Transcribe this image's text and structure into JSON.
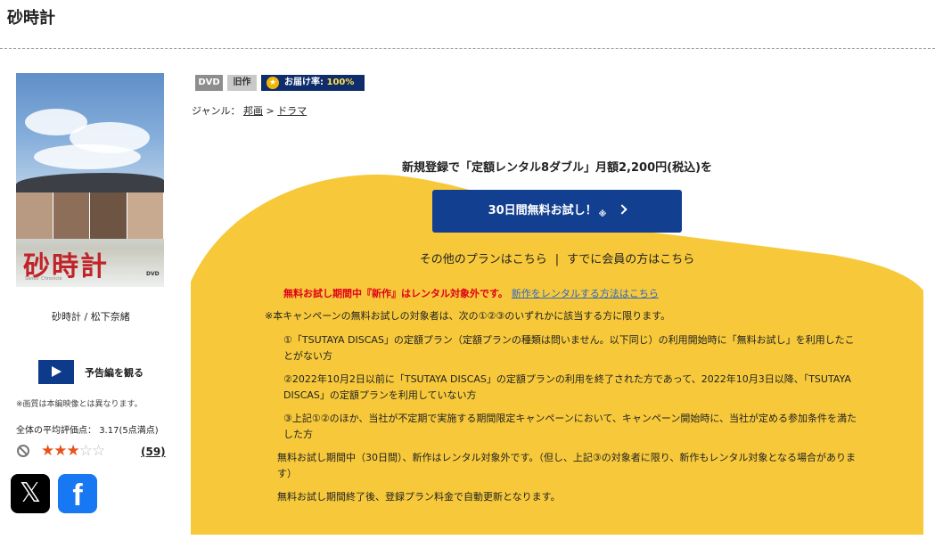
{
  "page": {
    "title": "砂時計"
  },
  "poster": {
    "title": "砂時計",
    "subtitle": "Sands' Chronicle",
    "logo": "DVD"
  },
  "cast": "砂時計 / 松下奈緒",
  "trailer": {
    "label": "予告編を観る"
  },
  "notice": "※画質は本編映像とは異なります。",
  "rating": {
    "label": "全体の平均評価点：",
    "value": "3.17",
    "scale_text": "(5点満点)",
    "stars": 3,
    "max_stars": 5,
    "review_count": "(59)"
  },
  "social": {
    "x_icon": "x-logo-icon",
    "facebook_icon": "facebook-logo-icon"
  },
  "badges": {
    "format": "DVD",
    "category": "旧作",
    "delivery_rate_label": "お届け率:",
    "delivery_rate_value": "100%"
  },
  "genre": {
    "label": "ジャンル：",
    "main": "邦画",
    "sep": " > ",
    "sub": "ドラマ"
  },
  "promo": {
    "headline": "新規登録で「定額レンタル8ダブル」月額2,200円(税込)を",
    "trial_button": "30日間無料お試し！",
    "trial_mark": "※",
    "other_plans": "その他のプランはこちら",
    "separator": "|",
    "member_link": "すでに会員の方はこちら",
    "red_notice": "無料お試し期間中『新作』はレンタル対象外です。",
    "red_link": "新作をレンタルする方法はこちら",
    "intro": "※本キャンペーンの無料お試しの対象者は、次の①②③のいずれかに該当する方に限ります。",
    "cond1": "①「TSUTAYA DISCAS」の定額プラン（定額プランの種類は問いません。以下同じ）の利用開始時に「無料お試し」を利用したことがない方",
    "cond2": "②2022年10月2日以前に「TSUTAYA DISCAS」の定額プランの利用を終了された方であって、2022年10月3日以降、「TSUTAYA DISCAS」の定額プランを利用していない方",
    "cond3": "③上記①②のほか、当社が不定期で実施する期間限定キャンペーンにおいて、キャンペーン開始時に、当社が定める参加条件を満たした方",
    "note1": "無料お試し期間中（30日間）、新作はレンタル対象外です。（但し、上記③の対象者に限り、新作もレンタル対象となる場合があります）",
    "note2": "無料お試し期間終了後、登録プラン料金で自動更新となります。"
  },
  "colors": {
    "accent_blue": "#123f8f",
    "promo_yellow": "#f7c93a",
    "notice_red": "#e0001b",
    "star": "#e8521c"
  }
}
